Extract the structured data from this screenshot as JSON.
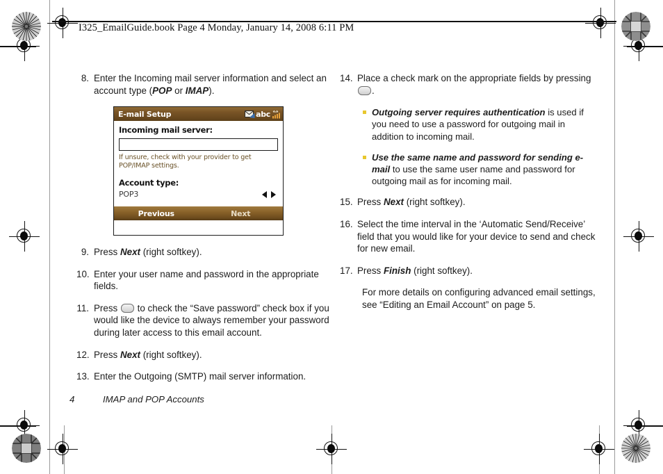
{
  "header": {
    "file_line": "I325_EmailGuide.book  Page 4  Monday, January 14, 2008  6:11 PM"
  },
  "left_column": {
    "steps": [
      {
        "number": "8.",
        "parts": [
          {
            "t": "text",
            "v": "Enter the Incoming mail server information and select an account type ("
          },
          {
            "t": "em",
            "v": "POP"
          },
          {
            "t": "text",
            "v": " or "
          },
          {
            "t": "em",
            "v": "IMAP"
          },
          {
            "t": "text",
            "v": ")."
          }
        ]
      },
      {
        "number": "9.",
        "parts": [
          {
            "t": "text",
            "v": "Press "
          },
          {
            "t": "em",
            "v": "Next"
          },
          {
            "t": "text",
            "v": " (right softkey)."
          }
        ]
      },
      {
        "number": "10.",
        "parts": [
          {
            "t": "text",
            "v": "Enter your user name and password in the appropriate fields."
          }
        ]
      },
      {
        "number": "11.",
        "parts": [
          {
            "t": "text",
            "v": "Press "
          },
          {
            "t": "key",
            "v": "center-select-key"
          },
          {
            "t": "text",
            "v": " to check the “Save password” check box if you would like the device to always remember your password during later access to this email account."
          }
        ]
      },
      {
        "number": "12.",
        "parts": [
          {
            "t": "text",
            "v": "Press "
          },
          {
            "t": "em",
            "v": "Next"
          },
          {
            "t": "text",
            "v": " (right softkey)."
          }
        ]
      },
      {
        "number": "13.",
        "parts": [
          {
            "t": "text",
            "v": "Enter the Outgoing (SMTP) mail server information."
          }
        ]
      }
    ]
  },
  "right_column": {
    "steps": [
      {
        "number": "14.",
        "parts": [
          {
            "t": "text",
            "v": "Place a check mark on the appropriate fields by pressing "
          },
          {
            "t": "key",
            "v": "center-select-key"
          },
          {
            "t": "text",
            "v": "."
          }
        ]
      }
    ],
    "bullets": [
      {
        "parts": [
          {
            "t": "em",
            "v": "Outgoing server requires authentication"
          },
          {
            "t": "text",
            "v": " is used if you need to use a password for outgoing mail in addition to incoming mail."
          }
        ]
      },
      {
        "parts": [
          {
            "t": "em",
            "v": "Use the same name and password for sending e-mail"
          },
          {
            "t": "text",
            "v": " to use the same user name and password for outgoing mail as for incoming mail."
          }
        ]
      }
    ],
    "steps_after": [
      {
        "number": "15.",
        "parts": [
          {
            "t": "text",
            "v": "Press "
          },
          {
            "t": "em",
            "v": "Next"
          },
          {
            "t": "text",
            "v": " (right softkey)."
          }
        ]
      },
      {
        "number": "16.",
        "parts": [
          {
            "t": "text",
            "v": "Select the time interval in the ‘Automatic Send/Receive’ field that you would like for your device to send and check for new email."
          }
        ]
      },
      {
        "number": "17.",
        "parts": [
          {
            "t": "text",
            "v": "Press "
          },
          {
            "t": "em",
            "v": "Finish"
          },
          {
            "t": "text",
            "v": " (right softkey)."
          }
        ]
      }
    ],
    "closing_note": "For more details on configuring advanced email settings, see “Editing an Email Account” on page 5."
  },
  "device_screenshot": {
    "title": "E-mail Setup",
    "status_icons": [
      "new-message-icon",
      "abc",
      "signal-bars-icon"
    ],
    "abc_label": "abc",
    "field_label": "Incoming mail server:",
    "field_value": "",
    "hint": "If unsure, check with your provider to get POP/IMAP settings.",
    "account_type_label": "Account type:",
    "account_type_value": "POP3",
    "softkey_left": "Previous",
    "softkey_right": "Next",
    "colors": {
      "title_bar": "#7a5526",
      "softkey_bar": "#8a6229",
      "hint_text": "#6a5228"
    }
  },
  "footer": {
    "page_number": "4",
    "section_title": "IMAP and POP Accounts"
  },
  "print_marks": {
    "bullet_color": "#e8c72e",
    "registration_marks": 8,
    "color_patches": 4
  }
}
